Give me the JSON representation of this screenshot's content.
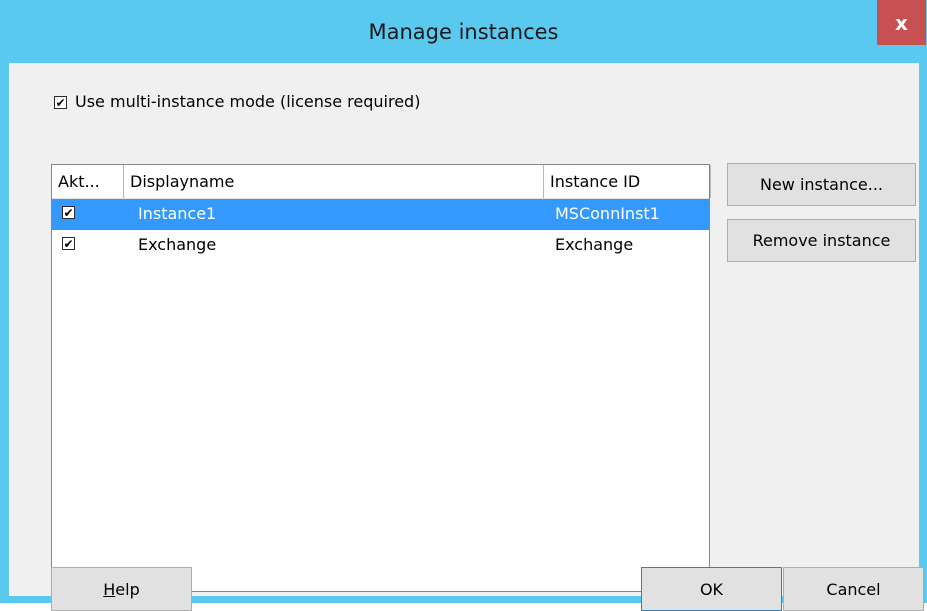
{
  "window": {
    "title": "Manage instances",
    "close_glyph": "x"
  },
  "options": {
    "multi_instance_label": "Use multi-instance mode (license required)",
    "multi_instance_checked": true
  },
  "instances": {
    "columns": [
      "Akt...",
      "Displayname",
      "Instance ID"
    ],
    "rows": [
      {
        "active": true,
        "display_name": "Instance1",
        "instance_id": "MSConnInst1",
        "selected": true
      },
      {
        "active": true,
        "display_name": "Exchange",
        "instance_id": "Exchange",
        "selected": false
      }
    ]
  },
  "buttons": {
    "new_instance": "New instance...",
    "remove_instance": "Remove instance",
    "help_mnemonic": "H",
    "help_rest": "elp",
    "ok": "OK",
    "cancel": "Cancel"
  },
  "check_glyph": "✔",
  "colors": {
    "titlebar": "#5ac9f0",
    "close_button": "#c75050",
    "selection": "#3399ff"
  }
}
